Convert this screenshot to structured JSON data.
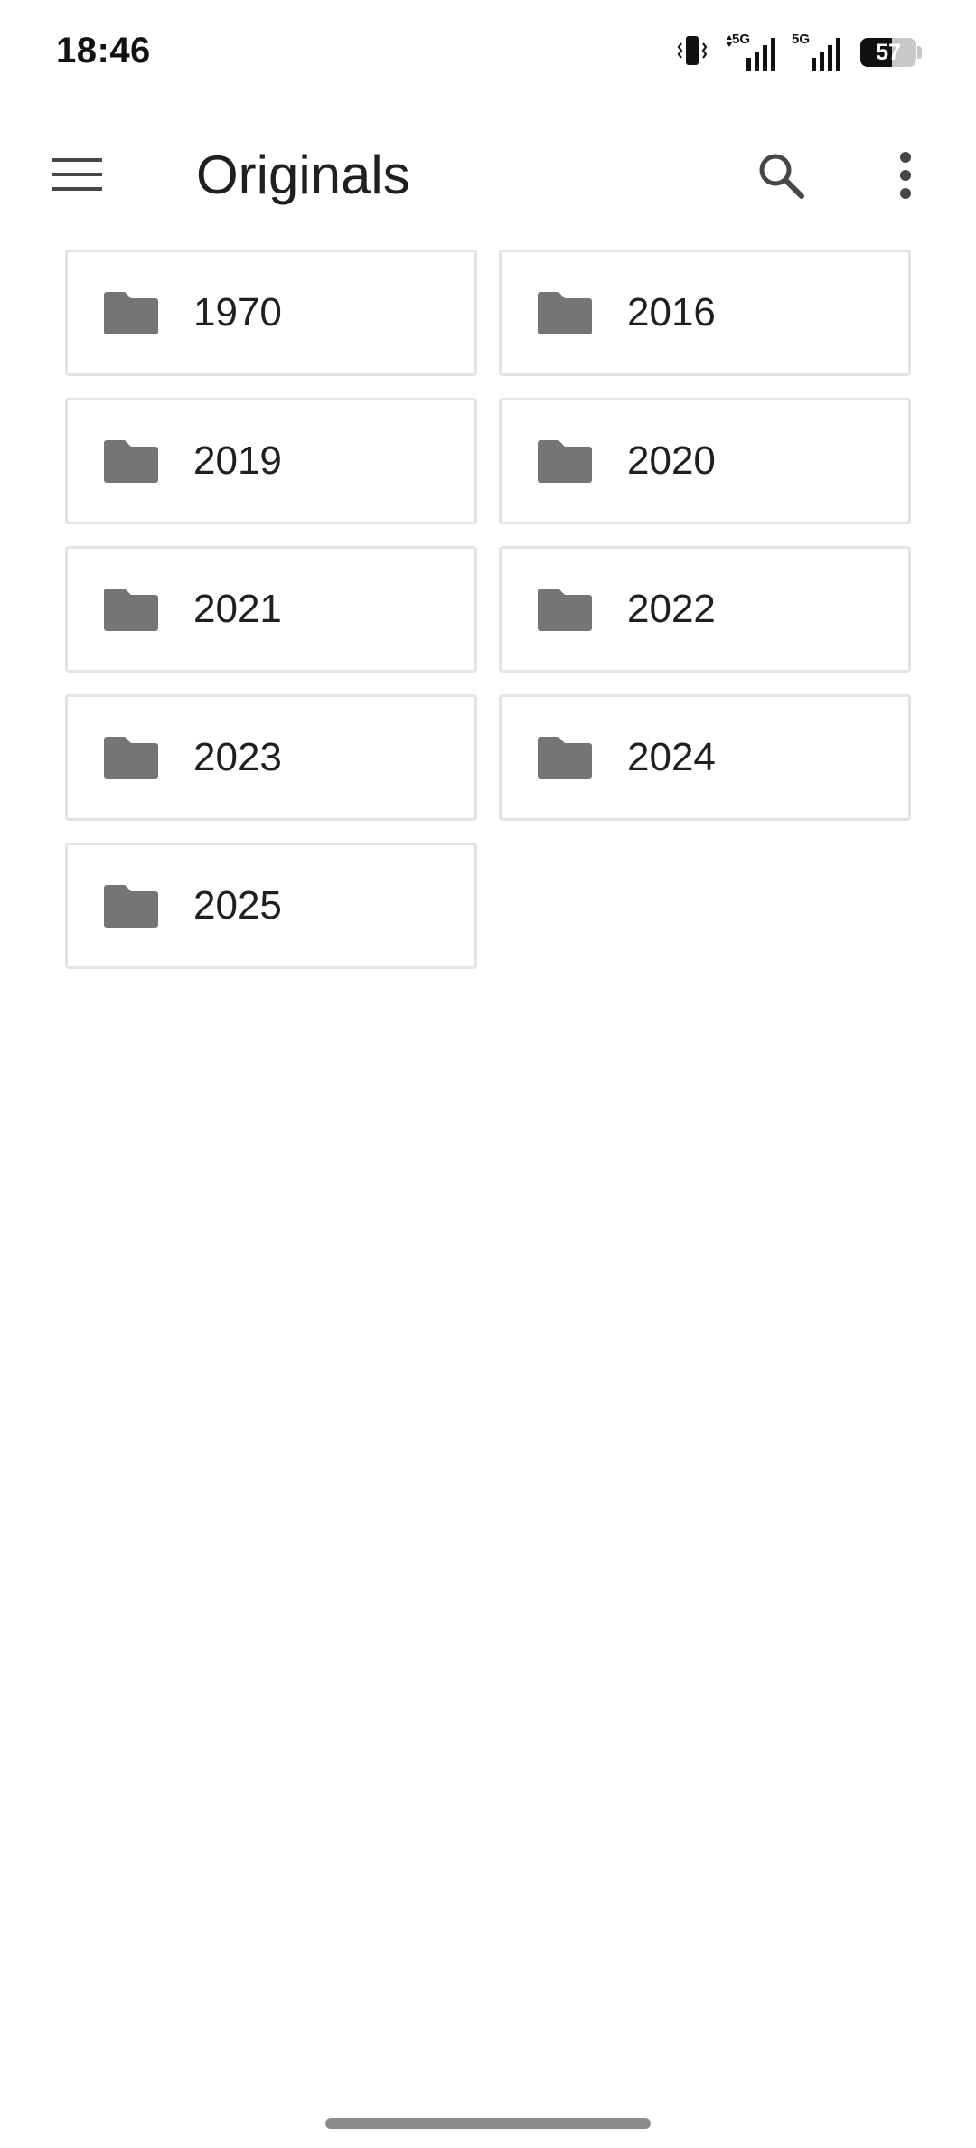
{
  "status_bar": {
    "time": "18:46",
    "network_1": "5G",
    "network_2": "5G",
    "battery_level": "57",
    "battery_fraction": 0.57
  },
  "app_bar": {
    "title": "Originals",
    "menu_icon": "hamburger-menu-icon",
    "search_icon": "search-icon",
    "more_icon": "more-vert-icon"
  },
  "folders": [
    {
      "name": "1970",
      "icon": "folder-icon"
    },
    {
      "name": "2016",
      "icon": "folder-icon"
    },
    {
      "name": "2019",
      "icon": "folder-icon"
    },
    {
      "name": "2020",
      "icon": "folder-icon"
    },
    {
      "name": "2021",
      "icon": "folder-icon"
    },
    {
      "name": "2022",
      "icon": "folder-icon"
    },
    {
      "name": "2023",
      "icon": "folder-icon"
    },
    {
      "name": "2024",
      "icon": "folder-icon"
    },
    {
      "name": "2025",
      "icon": "folder-icon"
    }
  ],
  "colors": {
    "background": "#ffffff",
    "folder_icon": "#757575",
    "card_border": "#e3e3e3",
    "text": "#1f1f1f"
  }
}
